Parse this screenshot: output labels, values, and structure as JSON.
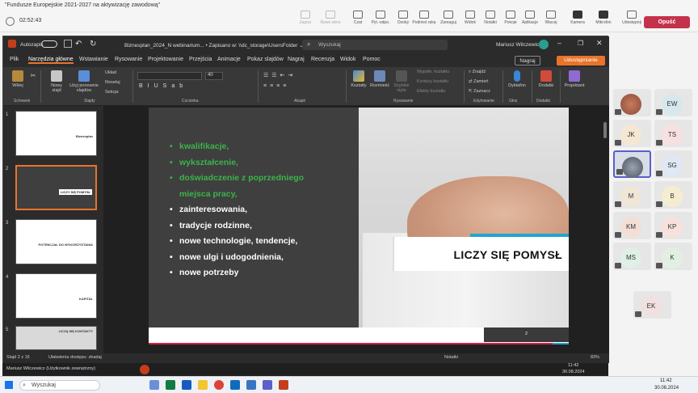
{
  "meeting": {
    "title": "\"Fundusze Europejskie 2021-2027 na aktywizację zawodową\"",
    "timer": "02:52:43",
    "toolbar": [
      {
        "label": "Zapisz",
        "disabled": true
      },
      {
        "label": "Nowe okno",
        "disabled": true
      },
      {
        "label": "Czat",
        "disabled": false
      },
      {
        "label": "Pyt.-odpo.",
        "disabled": false
      },
      {
        "label": "Osoby",
        "disabled": false
      },
      {
        "label": "Podnieś rękę",
        "disabled": false
      },
      {
        "label": "Zareaguj",
        "disabled": false
      },
      {
        "label": "Widok",
        "disabled": false
      },
      {
        "label": "Notatki",
        "disabled": false
      },
      {
        "label": "Pokoje",
        "disabled": false
      },
      {
        "label": "Aplikacje",
        "disabled": false
      },
      {
        "label": "Więcej",
        "disabled": false
      },
      {
        "label": "Kamera",
        "disabled": false
      },
      {
        "label": "Mikrofon",
        "disabled": false
      },
      {
        "label": "Udostępnij",
        "disabled": false
      }
    ],
    "leave_label": "Opuść",
    "participants": [
      {
        "initials": "",
        "photo": true
      },
      {
        "initials": "EW",
        "photo": false
      },
      {
        "initials": "JK",
        "photo": false
      },
      {
        "initials": "TS",
        "photo": false
      },
      {
        "initials": "",
        "photo": true
      },
      {
        "initials": "SG",
        "photo": false
      },
      {
        "initials": "M",
        "photo": false
      },
      {
        "initials": "B",
        "photo": false
      },
      {
        "initials": "KM",
        "photo": false
      },
      {
        "initials": "KP",
        "photo": false
      },
      {
        "initials": "MS",
        "photo": false
      },
      {
        "initials": "K",
        "photo": false
      },
      {
        "initials": "EK",
        "photo": false
      }
    ]
  },
  "ppt": {
    "autosave": "Autozapis",
    "doc_title": "Biznesplan_2024_N webinarium... • Zapisano w: \\\\dc_storage\\UsersFolder ⌄",
    "search_placeholder": "Wyszukaj",
    "user": "Mariusz Wilczewicz",
    "tabs": [
      "Plik",
      "Narzędzia główne",
      "Wstawianie",
      "Rysowanie",
      "Projektowanie",
      "Przejścia",
      "Animacje",
      "Pokaz slajdów",
      "Nagraj",
      "Recenzja",
      "Widok",
      "Pomoc"
    ],
    "record_btn": "Nagraj",
    "share_btn": "Udostępnianie",
    "ribbon": {
      "paste": "Wklej",
      "new_slide": "Nowy slajd",
      "reuse": "Użyj ponownie slajdów",
      "layout": "Układ",
      "reset": "Resetuj",
      "section": "Sekcja",
      "font_size": "40",
      "shapes": "Kształty",
      "arrange": "Rozmieść",
      "quick_styles": "Szybkie style",
      "fill": "Wypełn. kształtu",
      "outline": "Kontury kształtu",
      "effects": "Efekty kształtu",
      "find": "Znajdź",
      "replace": "Zamień",
      "select": "Zaznacz",
      "dictate": "Dyktafon",
      "addins": "Dodatki",
      "designer": "Projektant",
      "groups": [
        "Schowek",
        "Slajdy",
        "Czcionka",
        "Akapit",
        "Rysowanie",
        "Edytowanie",
        "Głos",
        "Dodatki"
      ]
    },
    "thumbnails": [
      {
        "num": "1",
        "caption": "Biznesplan"
      },
      {
        "num": "2",
        "caption": "LICZY SIĘ POMYSŁ"
      },
      {
        "num": "3",
        "caption": "POTENCJAŁ DO WYKORZYSTANIA"
      },
      {
        "num": "4",
        "caption": "KAPITAŁ"
      },
      {
        "num": "5",
        "caption": "LICZĄ SIĘ KONTAKTY"
      }
    ],
    "slide": {
      "bullets_green": [
        "kwalifikacje,",
        "wykształcenie,",
        "doświadczenie z poprzedniego",
        "miejsca pracy,"
      ],
      "bullets_white": [
        "zainteresowania,",
        "tradycje rodzinne,",
        "nowe technologie, tendencje,",
        "nowe ulgi i udogodnienia,",
        "nowe potrzeby"
      ],
      "card_title": "LICZY SIĘ POMYSŁ",
      "page_number": "2"
    },
    "status": {
      "slide": "Slajd 2 z 16",
      "accessibility": "Ułatwienia dostępu: zbadaj",
      "notes": "Notatki",
      "zoom": "83%"
    },
    "remote_taskbar": {
      "presenter": "Mariusz Wilczewicz (Użytkownik zewnętrzny)",
      "time": "11:42",
      "date": "30.08.2024"
    }
  },
  "windows_taskbar": {
    "search": "Wyszukaj",
    "time": "11:42",
    "date": "30.08.2024"
  }
}
